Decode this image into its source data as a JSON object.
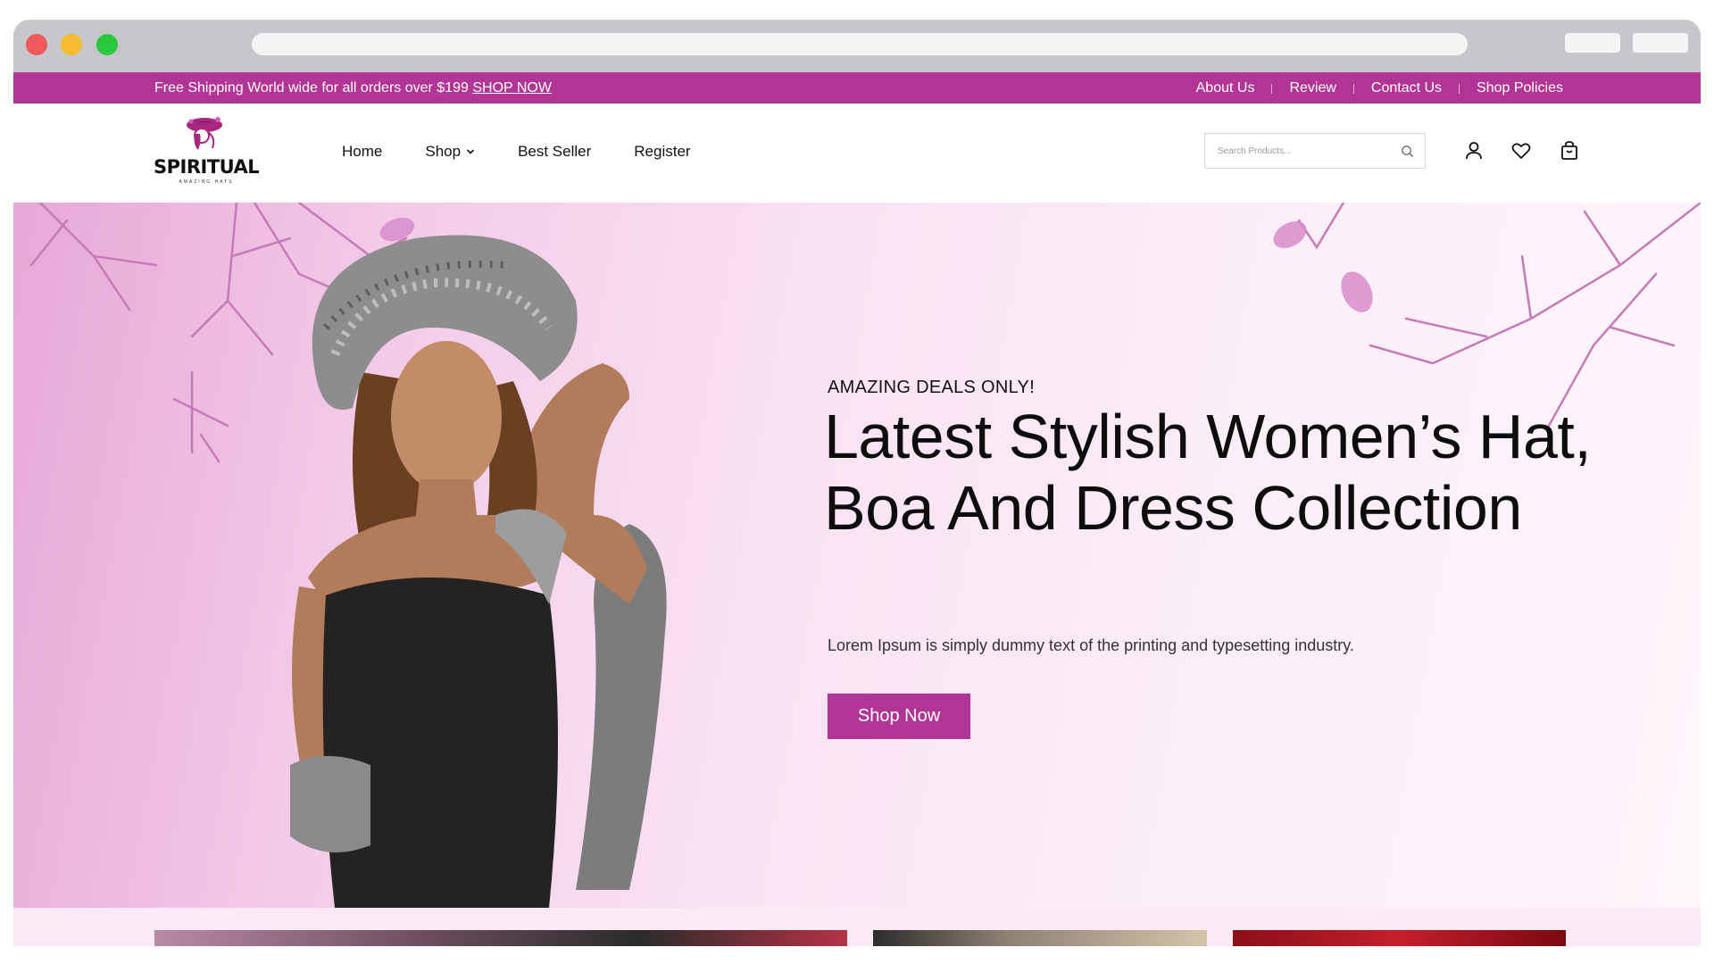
{
  "colors": {
    "brand": "#b03595",
    "promo_bar": "#b03595",
    "hero_bg": "#f5d4ec"
  },
  "topbar": {
    "promo_text": "Free Shipping World wide for all orders over $199",
    "promo_link": "SHOP NOW",
    "links": [
      "About Us",
      "Review",
      "Contact Us",
      "Shop Policies"
    ]
  },
  "header": {
    "logo": {
      "name": "SPIRITUAL",
      "tagline": "AMAZING HATS"
    },
    "nav": [
      "Home",
      "Shop",
      "Best Seller",
      "Register"
    ],
    "search": {
      "placeholder": "Search Products..."
    },
    "icons": [
      "search-icon",
      "user-icon",
      "heart-icon",
      "bag-icon"
    ]
  },
  "hero": {
    "eyebrow": "AMAZING DEALS ONLY!",
    "headline": "Latest Stylish Women’s Hat, Boa And Dress Collection",
    "subtext": "Lorem Ipsum is simply dummy text of the printing and typesetting industry.",
    "cta": "Shop Now"
  }
}
